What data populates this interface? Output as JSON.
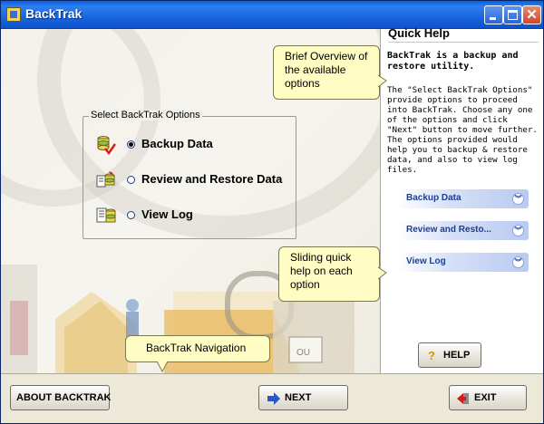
{
  "window": {
    "title": "BackTrak"
  },
  "options_group": {
    "legend": "Select BackTrak Options",
    "options": [
      {
        "label": "Backup Data",
        "selected": true,
        "icon": "database-check-icon"
      },
      {
        "label": "Review and Restore Data",
        "selected": false,
        "icon": "review-restore-icon"
      },
      {
        "label": "View Log",
        "selected": false,
        "icon": "view-log-icon"
      }
    ]
  },
  "tooltips": {
    "overview": "Brief Overview of the available options",
    "sliding": "Sliding quick help on each option",
    "navigation": "BackTrak  Navigation"
  },
  "quick_help": {
    "title": "Quick Help",
    "heading": "BackTrak is a backup and restore utility.",
    "body": "The \"Select BackTrak Options\" provide options to proceed into BackTrak. Choose any one of the options and click \"Next\" button to move further.  The options provided would help you to backup & restore data, and also to view log files.",
    "sliders": [
      {
        "label": "Backup Data"
      },
      {
        "label": "Review and Resto..."
      },
      {
        "label": "View Log"
      }
    ],
    "help_button": "HELP"
  },
  "buttons": {
    "about": "ABOUT BACKTRAK",
    "next": "NEXT",
    "exit": "EXIT"
  },
  "colors": {
    "titlebar": "#1b64e0",
    "tooltip_bg": "#fffcc4",
    "slider_text": "#1c3f94"
  }
}
